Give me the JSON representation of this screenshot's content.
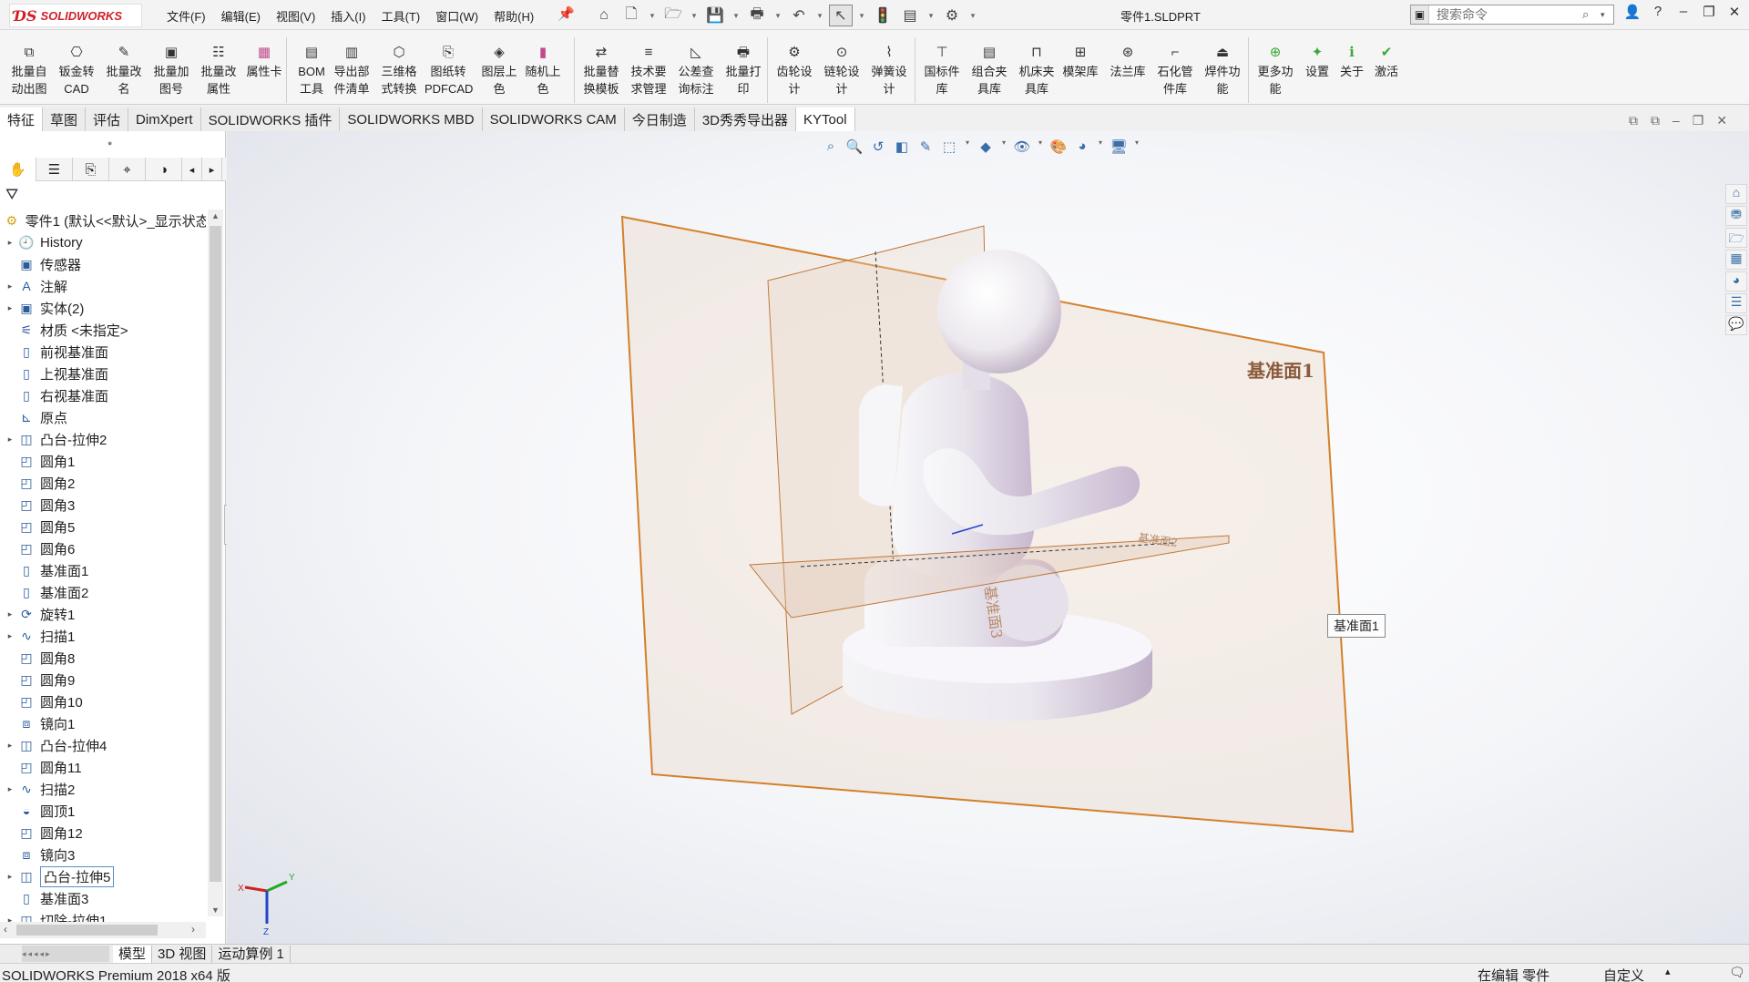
{
  "app": {
    "logo_ds": "ƊS",
    "logo_name": "SOLIDWORKS",
    "doc_title": "零件1.SLDPRT"
  },
  "menu": [
    "文件(F)",
    "编辑(E)",
    "视图(V)",
    "插入(I)",
    "工具(T)",
    "窗口(W)",
    "帮助(H)"
  ],
  "search": {
    "placeholder": "搜索命令"
  },
  "commands": [
    {
      "label": "批量自\n动出图",
      "icon": "batch-drawing-icon"
    },
    {
      "label": "钣金转\nCAD",
      "icon": "sheetmetal-cad-icon"
    },
    {
      "label": "批量改\n名",
      "icon": "batch-rename-icon"
    },
    {
      "label": "批量加\n图号",
      "icon": "batch-number-icon"
    },
    {
      "label": "批量改\n属性",
      "icon": "batch-property-icon"
    },
    {
      "label": "属性卡",
      "icon": "property-card-icon"
    },
    {
      "label": "BOM\n工具",
      "icon": "bom-icon"
    },
    {
      "label": "导出部\n件清单",
      "icon": "export-list-icon"
    },
    {
      "label": "三维格\n式转换",
      "icon": "3d-convert-icon"
    },
    {
      "label": "图纸转\nPDFCAD",
      "icon": "pdf-convert-icon"
    },
    {
      "label": "图层上\n色",
      "icon": "layer-color-icon"
    },
    {
      "label": "随机上\n色",
      "icon": "random-color-icon"
    },
    {
      "label": "批量替\n换模板",
      "icon": "template-icon"
    },
    {
      "label": "技术要\n求管理",
      "icon": "tech-req-icon"
    },
    {
      "label": "公差查\n询标注",
      "icon": "tolerance-icon"
    },
    {
      "label": "批量打\n印",
      "icon": "print-icon"
    },
    {
      "label": "齿轮设\n计",
      "icon": "gear-icon"
    },
    {
      "label": "链轮设\n计",
      "icon": "sprocket-icon"
    },
    {
      "label": "弹簧设\n计",
      "icon": "spring-icon"
    },
    {
      "label": "国标件\n库",
      "icon": "standard-parts-icon"
    },
    {
      "label": "组合夹\n具库",
      "icon": "fixture-icon"
    },
    {
      "label": "机床夹\n具库",
      "icon": "machine-fixture-icon"
    },
    {
      "label": "模架库",
      "icon": "mold-base-icon"
    },
    {
      "label": "法兰库",
      "icon": "flange-icon"
    },
    {
      "label": "石化管\n件库",
      "icon": "pipe-icon"
    },
    {
      "label": "焊件功\n能",
      "icon": "weldment-icon"
    },
    {
      "label": "更多功\n能",
      "icon": "more-icon"
    },
    {
      "label": "设置",
      "icon": "settings-icon"
    },
    {
      "label": "关于",
      "icon": "info-icon"
    },
    {
      "label": "激活",
      "icon": "activate-icon"
    }
  ],
  "tabs": [
    "特征",
    "草图",
    "评估",
    "DimXpert",
    "SOLIDWORKS 插件",
    "SOLIDWORKS MBD",
    "SOLIDWORKS CAM",
    "今日制造",
    "3D秀秀导出器",
    "KYTool"
  ],
  "tree": {
    "root": "零件1 (默认<<默认>_显示状态",
    "items": [
      {
        "label": "History",
        "exp": true,
        "icon": "history-icon"
      },
      {
        "label": "传感器",
        "exp": false,
        "icon": "sensor-icon"
      },
      {
        "label": "注解",
        "exp": true,
        "icon": "annotation-icon"
      },
      {
        "label": "实体(2)",
        "exp": true,
        "icon": "solid-bodies-icon"
      },
      {
        "label": "材质 <未指定>",
        "exp": false,
        "icon": "material-icon"
      },
      {
        "label": "前视基准面",
        "exp": false,
        "icon": "plane-icon"
      },
      {
        "label": "上视基准面",
        "exp": false,
        "icon": "plane-icon"
      },
      {
        "label": "右视基准面",
        "exp": false,
        "icon": "plane-icon"
      },
      {
        "label": "原点",
        "exp": false,
        "icon": "origin-icon"
      },
      {
        "label": "凸台-拉伸2",
        "exp": true,
        "icon": "extrude-icon"
      },
      {
        "label": "圆角1",
        "exp": false,
        "icon": "fillet-icon"
      },
      {
        "label": "圆角2",
        "exp": false,
        "icon": "fillet-icon"
      },
      {
        "label": "圆角3",
        "exp": false,
        "icon": "fillet-icon"
      },
      {
        "label": "圆角5",
        "exp": false,
        "icon": "fillet-icon"
      },
      {
        "label": "圆角6",
        "exp": false,
        "icon": "fillet-icon"
      },
      {
        "label": "基准面1",
        "exp": false,
        "icon": "plane-icon"
      },
      {
        "label": "基准面2",
        "exp": false,
        "icon": "plane-icon"
      },
      {
        "label": "旋转1",
        "exp": true,
        "icon": "revolve-icon"
      },
      {
        "label": "扫描1",
        "exp": true,
        "icon": "sweep-icon"
      },
      {
        "label": "圆角8",
        "exp": false,
        "icon": "fillet-icon"
      },
      {
        "label": "圆角9",
        "exp": false,
        "icon": "fillet-icon"
      },
      {
        "label": "圆角10",
        "exp": false,
        "icon": "fillet-icon"
      },
      {
        "label": "镜向1",
        "exp": false,
        "icon": "mirror-icon"
      },
      {
        "label": "凸台-拉伸4",
        "exp": true,
        "icon": "extrude-icon"
      },
      {
        "label": "圆角11",
        "exp": false,
        "icon": "fillet-icon"
      },
      {
        "label": "扫描2",
        "exp": true,
        "icon": "sweep-icon"
      },
      {
        "label": "圆顶1",
        "exp": false,
        "icon": "dome-icon"
      },
      {
        "label": "圆角12",
        "exp": false,
        "icon": "fillet-icon"
      },
      {
        "label": "镜向3",
        "exp": false,
        "icon": "mirror-icon"
      },
      {
        "label": "凸台-拉伸5",
        "exp": true,
        "icon": "extrude-icon",
        "highlight": true
      },
      {
        "label": "基准面3",
        "exp": false,
        "icon": "plane-icon"
      },
      {
        "label": "切除-拉伸1",
        "exp": true,
        "icon": "cut-icon"
      }
    ]
  },
  "viewport": {
    "plane1_label": "基准面1",
    "plane2_label": "基准面2",
    "plane3_label": "基准面3",
    "tooltip": "基准面1",
    "triad": {
      "x": "X",
      "y": "Y",
      "z": "Z"
    }
  },
  "bottom_tabs": [
    "模型",
    "3D 视图",
    "运动算例 1"
  ],
  "status": {
    "left": "SOLIDWORKS Premium 2018 x64 版",
    "mode": "在编辑 零件",
    "units": "自定义"
  },
  "colors": {
    "accent": "#d0202a",
    "plane_edge": "#d4802a",
    "plane_fill": "#e8d0c0",
    "selection": "#5a8fc8"
  }
}
